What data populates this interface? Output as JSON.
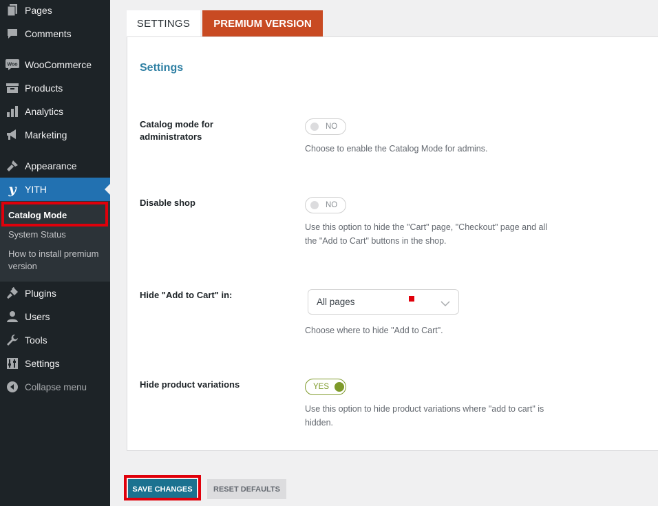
{
  "sidebar": {
    "items": [
      {
        "label": "Pages",
        "icon": "pages-icon"
      },
      {
        "label": "Comments",
        "icon": "comments-icon"
      },
      {
        "label": "WooCommerce",
        "icon": "woocommerce-icon"
      },
      {
        "label": "Products",
        "icon": "products-icon"
      },
      {
        "label": "Analytics",
        "icon": "analytics-icon"
      },
      {
        "label": "Marketing",
        "icon": "marketing-icon"
      },
      {
        "label": "Appearance",
        "icon": "appearance-icon"
      },
      {
        "label": "YITH",
        "icon": "yith-icon"
      },
      {
        "label": "Plugins",
        "icon": "plugins-icon"
      },
      {
        "label": "Users",
        "icon": "users-icon"
      },
      {
        "label": "Tools",
        "icon": "tools-icon"
      },
      {
        "label": "Settings",
        "icon": "settings-icon"
      },
      {
        "label": "Collapse menu",
        "icon": "collapse-icon"
      }
    ],
    "woo_logo_text": "Woo",
    "yith_logo_text": "y",
    "submenu": [
      "Catalog Mode",
      "System Status",
      "How to install premium version"
    ]
  },
  "tabs": {
    "settings": "SETTINGS",
    "premium": "PREMIUM VERSION"
  },
  "panel": {
    "title": "Settings",
    "fields": [
      {
        "label": "Catalog mode for administrators",
        "toggle": "NO",
        "description": "Choose to enable the Catalog Mode for admins."
      },
      {
        "label": "Disable shop",
        "toggle": "NO",
        "description": "Use this option to hide the \"Cart\" page, \"Checkout\" page and all the \"Add to Cart\" buttons in the shop."
      },
      {
        "label": "Hide \"Add to Cart\" in:",
        "select_value": "All pages",
        "description": "Choose where to hide \"Add to Cart\"."
      },
      {
        "label": "Hide product variations",
        "toggle": "YES",
        "description": "Use this option to hide product variations where \"add to cart\" is hidden."
      }
    ]
  },
  "buttons": {
    "save": "SAVE CHANGES",
    "reset": "RESET DEFAULTS"
  },
  "colors": {
    "sidebar_bg": "#1d2327",
    "active_menu": "#2271b1",
    "premium_tab": "#c84a22",
    "save_button": "#1b7290",
    "toggle_on": "#7e9a2a",
    "highlight": "#e0000b"
  }
}
